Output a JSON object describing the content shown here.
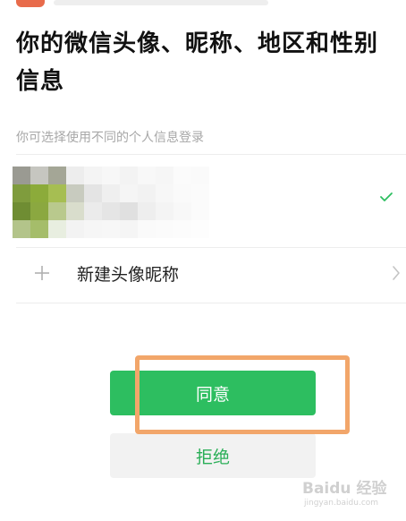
{
  "title": "你的微信头像、昵称、地区和性别信息",
  "subtitle": "你可选择使用不同的个人信息登录",
  "new_profile_label": "新建头像昵称",
  "agree_label": "同意",
  "reject_label": "拒绝",
  "watermark": {
    "main": "Baidu 经验",
    "sub": "jingyan.baidu.com"
  },
  "colors": {
    "accent": "#2dbe60",
    "highlight": "#f2a66a"
  },
  "icons": {
    "check": "check-icon",
    "plus": "plus-icon",
    "chevron": "chevron-right-icon"
  }
}
